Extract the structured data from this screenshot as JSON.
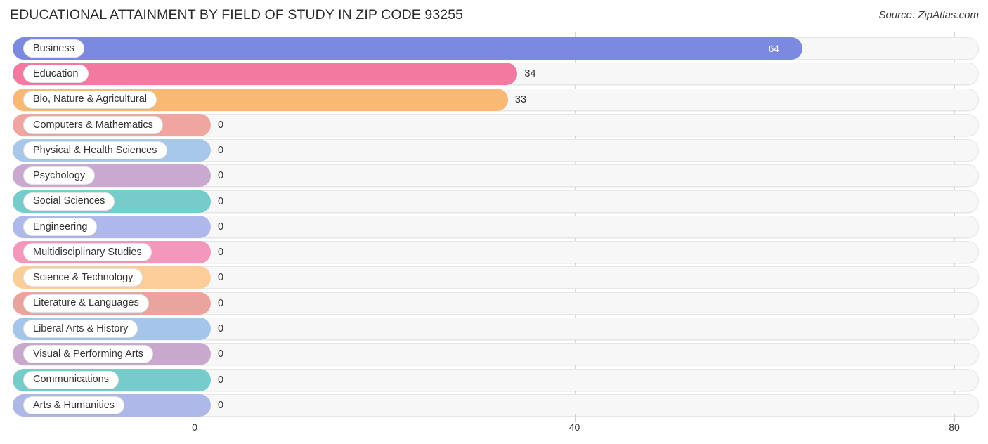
{
  "header": {
    "title": "EDUCATIONAL ATTAINMENT BY FIELD OF STUDY IN ZIP CODE 93255",
    "source": "Source: ZipAtlas.com"
  },
  "chart_data": {
    "type": "bar",
    "orientation": "horizontal",
    "title": "EDUCATIONAL ATTAINMENT BY FIELD OF STUDY IN ZIP CODE 93255",
    "xlabel": "",
    "ylabel": "",
    "xlim": [
      0,
      80
    ],
    "xticks": [
      0,
      40,
      80
    ],
    "xtick_labels": [
      "0",
      "40",
      "80"
    ],
    "grid": true,
    "legend": false,
    "categories": [
      "Business",
      "Education",
      "Bio, Nature & Agricultural",
      "Computers & Mathematics",
      "Physical & Health Sciences",
      "Psychology",
      "Social Sciences",
      "Engineering",
      "Multidisciplinary Studies",
      "Science & Technology",
      "Literature & Languages",
      "Liberal Arts & History",
      "Visual & Performing Arts",
      "Communications",
      "Arts & Humanities"
    ],
    "values": [
      64,
      34,
      33,
      0,
      0,
      0,
      0,
      0,
      0,
      0,
      0,
      0,
      0,
      0,
      0
    ],
    "value_labels": [
      "64",
      "34",
      "33",
      "0",
      "0",
      "0",
      "0",
      "0",
      "0",
      "0",
      "0",
      "0",
      "0",
      "0",
      "0"
    ],
    "colors": [
      "#7b8ae0",
      "#f2799f",
      "#f9b873",
      "#f0a6a0",
      "#a8c8ea",
      "#c9a9cf",
      "#76cccb",
      "#afb8ea",
      "#f497bc",
      "#fbcd99",
      "#eaa49e",
      "#a5c6ea",
      "#c9a8cd",
      "#76cccb",
      "#aeb8e8"
    ]
  },
  "axis": {
    "ticks": [
      "0",
      "40",
      "80"
    ]
  }
}
